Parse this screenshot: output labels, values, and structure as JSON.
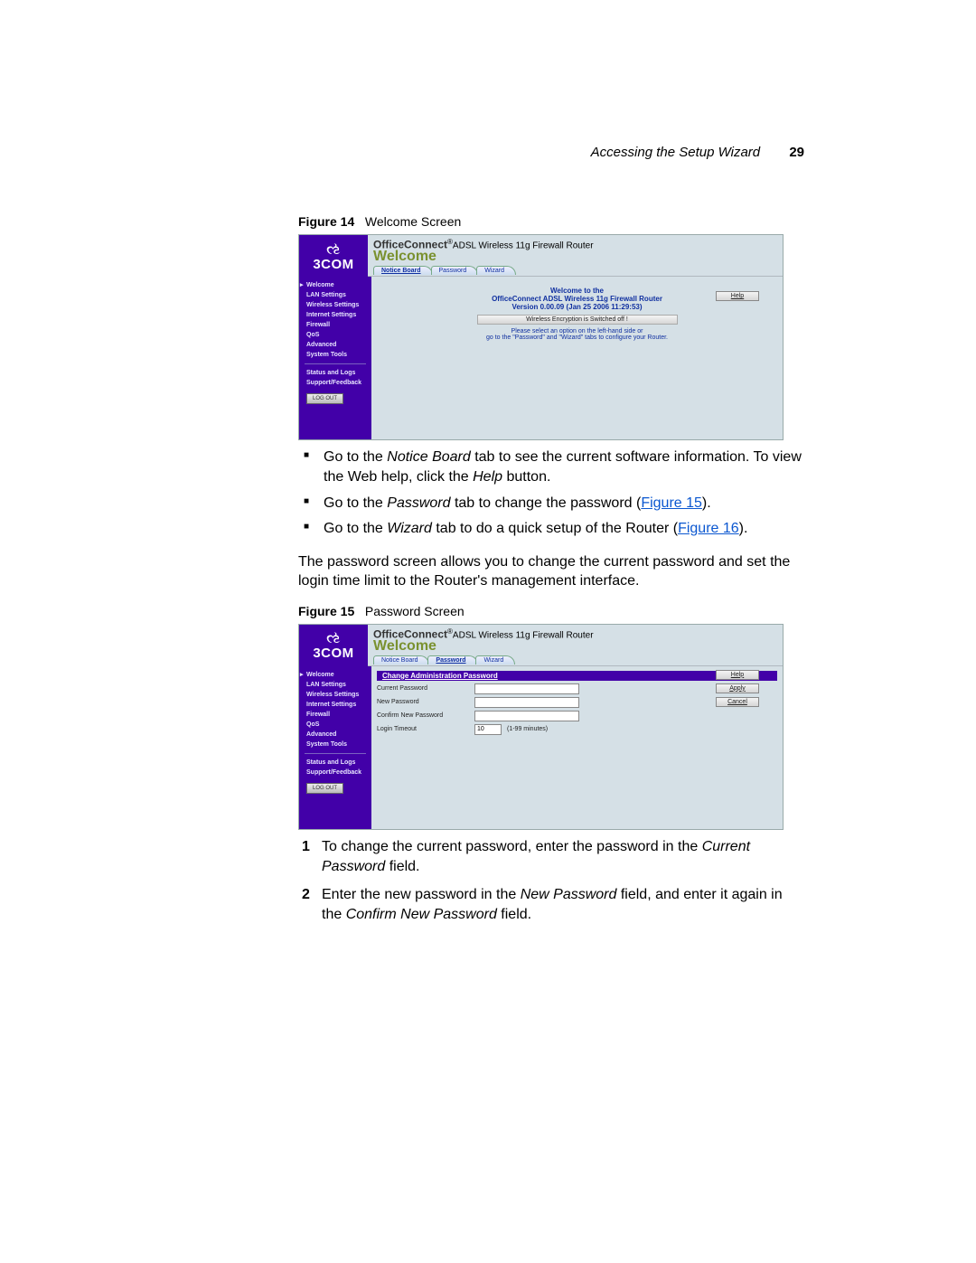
{
  "header": {
    "running": "Accessing the Setup Wizard",
    "pagenum": "29"
  },
  "fig14_caption_bold": "Figure 14",
  "fig14_caption_rest": "Welcome Screen",
  "fig15_caption_bold": "Figure 15",
  "fig15_caption_rest": "Password Screen",
  "brand_logo": "3COM",
  "product_bold": "OfficeConnect",
  "product_rest": "ADSL Wireless 11g Firewall Router",
  "page_heading": "Welcome",
  "tabs": {
    "notice": "Notice Board",
    "password": "Password",
    "wizard": "Wizard"
  },
  "sidebar": {
    "items": [
      "Welcome",
      "LAN Settings",
      "Wireless Settings",
      "Internet Settings",
      "Firewall",
      "QoS",
      "Advanced",
      "System Tools"
    ],
    "lower": [
      "Status and Logs",
      "Support/Feedback"
    ],
    "logout": "LOG OUT"
  },
  "fig14": {
    "welcome_line1": "Welcome to the",
    "welcome_line2": "OfficeConnect ADSL Wireless 11g Firewall Router",
    "welcome_line3": "Version 0.00.09 (Jan 25 2006 11:29:53)",
    "status": "Wireless Encryption is Switched off !",
    "instr1": "Please select an option on the left-hand side or",
    "instr2": "go to the \"Password\" and \"Wizard\" tabs to configure your Router.",
    "help": "Help"
  },
  "fig15": {
    "panel": "Change Administration Password",
    "current": "Current Password",
    "newp": "New Password",
    "confirm": "Confirm New Password",
    "timeout_lbl": "Login Timeout",
    "timeout_val": "10",
    "timeout_hint": "(1-99 minutes)",
    "help": "Help",
    "apply": "Apply",
    "cancel": "Cancel"
  },
  "bullets": {
    "b1a": "Go to the ",
    "b1_em": "Notice Board",
    "b1b": " tab to see the current software information. To view the Web help, click the ",
    "b1_em2": "Help",
    "b1c": " button.",
    "b2a": "Go to the ",
    "b2_em": "Password",
    "b2b": " tab to change the password (",
    "b2_link": "Figure 15",
    "b2c": ").",
    "b3a": "Go to the ",
    "b3_em": "Wizard",
    "b3b": " tab to do a quick setup of the Router (",
    "b3_link": "Figure 16",
    "b3c": ")."
  },
  "para1": "The password screen allows you to change the current password and set the login time limit to the Router's management interface.",
  "steps": {
    "s1a": "To change the current password, enter the password in the ",
    "s1_em": "Current Password",
    "s1b": " field.",
    "s2a": "Enter the new password in the ",
    "s2_em1": "New Password",
    "s2b": " field, and enter it again in the ",
    "s2_em2": "Confirm New Password",
    "s2c": " field."
  }
}
